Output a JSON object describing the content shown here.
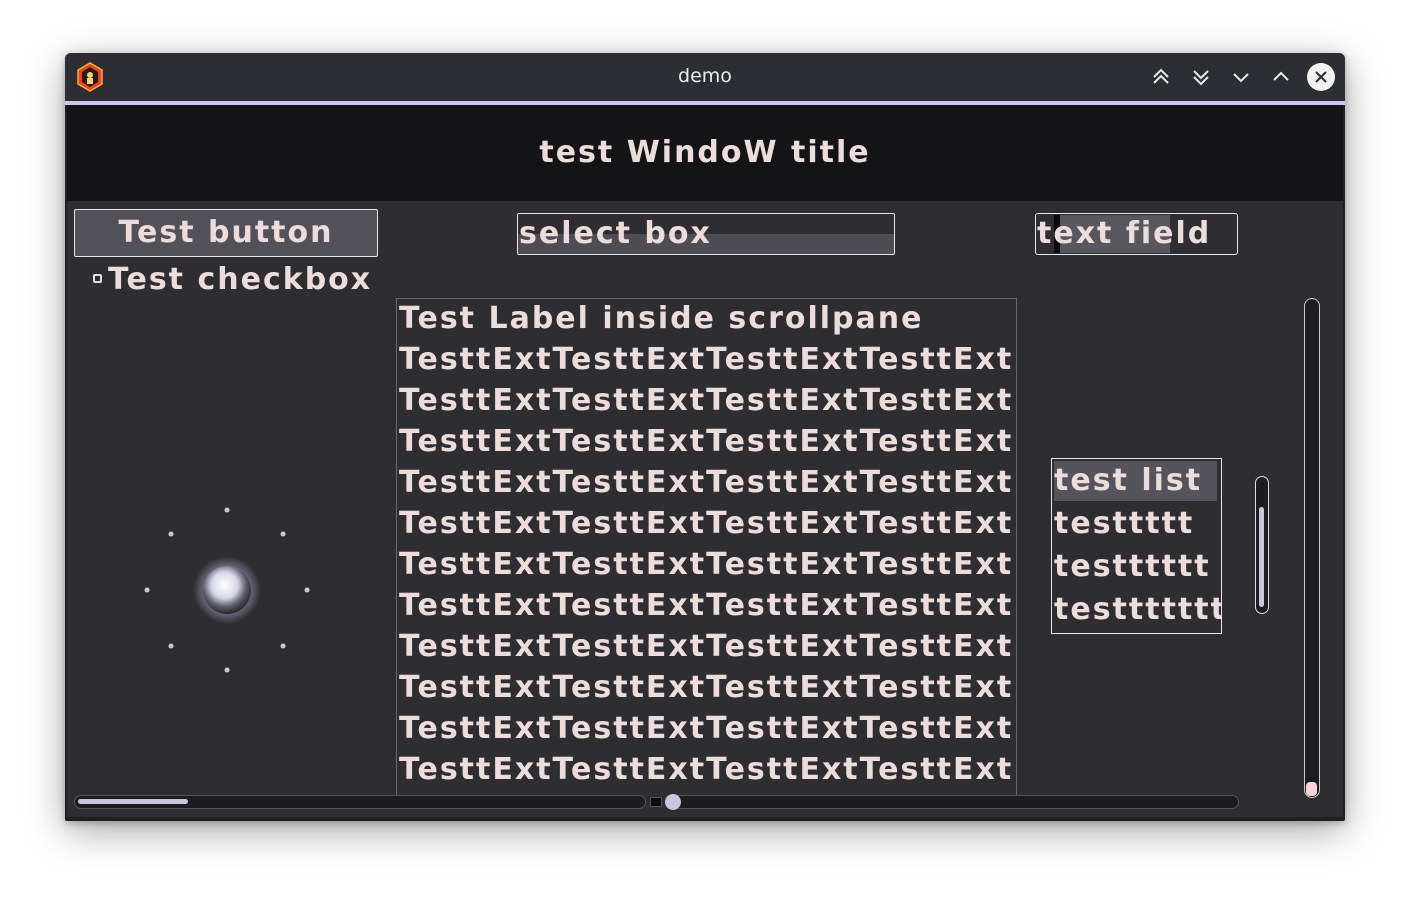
{
  "window": {
    "wm_title": "demo",
    "wm_buttons": [
      "keep-above-icon",
      "keep-below-icon",
      "minimize-icon",
      "maximize-icon",
      "close-icon"
    ]
  },
  "header": {
    "title": "test WindoW title"
  },
  "controls": {
    "button_label": "Test button",
    "checkbox_label": "Test checkbox",
    "checkbox_checked": false,
    "select_value": "select box",
    "text_field_value": "text field"
  },
  "scrollpane": {
    "heading": "Test Label inside scrollpane",
    "lines": [
      "TesttExtTesttExtTesttExtTesttExt",
      "TesttExtTesttExtTesttExtTesttExt",
      "TesttExtTesttExtTesttExtTesttExt",
      "TesttExtTesttExtTesttExtTesttExt",
      "TesttExtTesttExtTesttExtTesttExt",
      "TesttExtTesttExtTesttExtTesttExt",
      "TesttExtTesttExtTesttExtTesttExt",
      "TesttExtTesttExtTesttExtTesttExt",
      "TesttExtTesttExtTesttExtTesttExt",
      "TesttExtTesttExtTesttExtTesttExt",
      "TesttExtTesttExtTesttExtTesttExt"
    ]
  },
  "list": {
    "items": [
      "test list",
      "testtttt",
      "testttttt",
      "testtttttt"
    ],
    "selected_index": 0
  },
  "colors": {
    "accent": "#c9c8ec",
    "text": "#ecdcda",
    "background": "#2e2d31",
    "header_background": "#141416"
  }
}
